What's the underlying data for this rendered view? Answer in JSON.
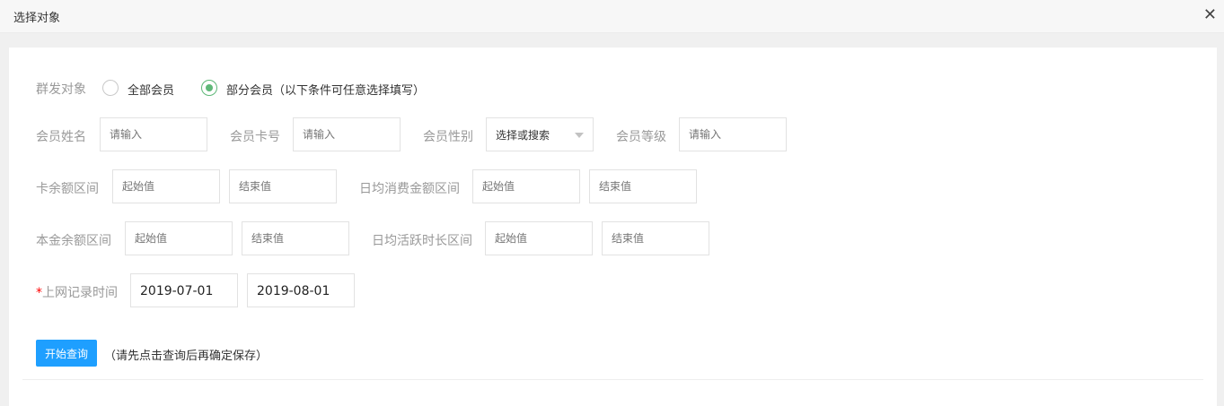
{
  "dialog": {
    "title": "选择对象",
    "close_icon": "close-icon"
  },
  "target": {
    "label": "群发对象",
    "options": [
      {
        "label": "全部会员",
        "selected": false
      },
      {
        "label": "部分会员（以下条件可任意选择填写）",
        "selected": true
      }
    ]
  },
  "fields": {
    "name": {
      "label": "会员姓名",
      "placeholder": "请输入"
    },
    "card": {
      "label": "会员卡号",
      "placeholder": "请输入"
    },
    "gender": {
      "label": "会员性别",
      "value": "选择或搜索"
    },
    "level": {
      "label": "会员等级",
      "placeholder": "请输入"
    },
    "card_balance": {
      "label": "卡余额区间",
      "start": "起始值",
      "end": "结束值"
    },
    "daily_spend": {
      "label": "日均消费金额区间",
      "start": "起始值",
      "end": "结束值"
    },
    "principal": {
      "label": "本金余额区间",
      "start": "起始值",
      "end": "结束值"
    },
    "daily_active": {
      "label": "日均活跃时长区间",
      "start": "起始值",
      "end": "结束值"
    },
    "online_time": {
      "required_mark": "*",
      "label": "上网记录时间",
      "start": "2019-07-01",
      "end": "2019-08-01"
    }
  },
  "query": {
    "button": "开始查询",
    "hint": "（请先点击查询后再确定保存）"
  },
  "colors": {
    "primary": "#1e9fff",
    "radio": "#5fb878",
    "required": "#ff0000"
  }
}
